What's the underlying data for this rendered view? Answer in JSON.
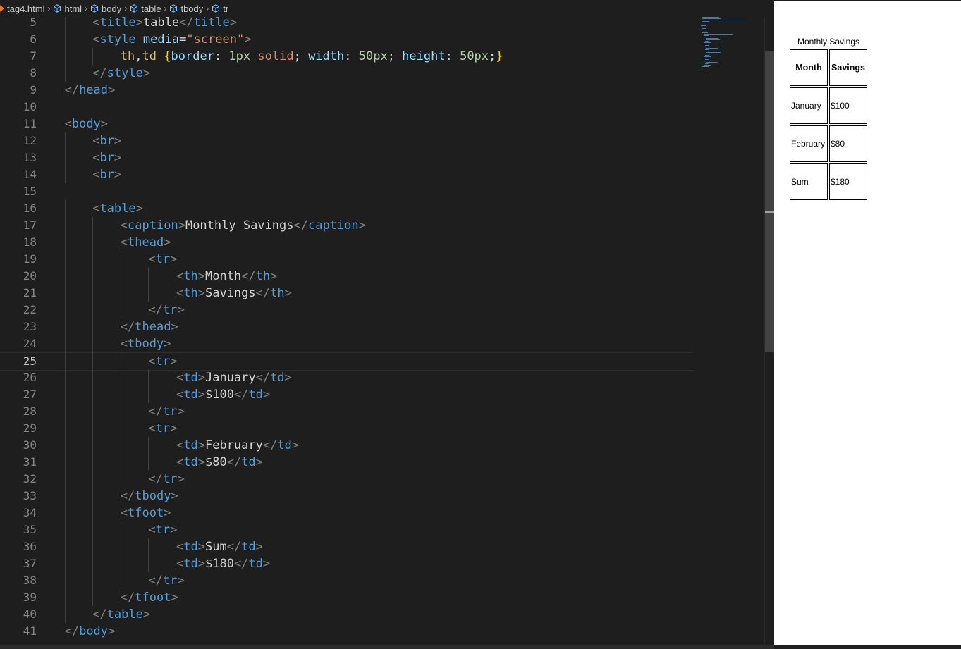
{
  "breadcrumb": {
    "file": "tag4.html",
    "items": [
      "html",
      "body",
      "table",
      "tbody",
      "tr"
    ]
  },
  "editor": {
    "active_line": 25,
    "lines": [
      {
        "n": "5",
        "indent": 2,
        "tokens": [
          [
            "br",
            "<"
          ],
          [
            "tag",
            "title"
          ],
          [
            "br",
            ">"
          ],
          [
            "txt",
            "table"
          ],
          [
            "br",
            "</"
          ],
          [
            "tag",
            "title"
          ],
          [
            "br",
            ">"
          ]
        ]
      },
      {
        "n": "6",
        "indent": 2,
        "tokens": [
          [
            "br",
            "<"
          ],
          [
            "tag",
            "style"
          ],
          [
            "txt",
            " "
          ],
          [
            "attr",
            "media"
          ],
          [
            "txt",
            "="
          ],
          [
            "str",
            "\"screen\""
          ],
          [
            "br",
            ">"
          ]
        ]
      },
      {
        "n": "7",
        "indent": 3,
        "tokens": [
          [
            "sel",
            "th"
          ],
          [
            "txt",
            ","
          ],
          [
            "sel",
            "td"
          ],
          [
            "txt",
            " "
          ],
          [
            "brace",
            "{"
          ],
          [
            "attr",
            "border"
          ],
          [
            "txt",
            ": "
          ],
          [
            "num",
            "1px"
          ],
          [
            "txt",
            " "
          ],
          [
            "val",
            "solid"
          ],
          [
            "txt",
            "; "
          ],
          [
            "attr",
            "width"
          ],
          [
            "txt",
            ": "
          ],
          [
            "num",
            "50px"
          ],
          [
            "txt",
            "; "
          ],
          [
            "attr",
            "height"
          ],
          [
            "txt",
            ": "
          ],
          [
            "num",
            "50px"
          ],
          [
            "txt",
            ";"
          ],
          [
            "brace",
            "}"
          ]
        ]
      },
      {
        "n": "8",
        "indent": 2,
        "tokens": [
          [
            "br",
            "</"
          ],
          [
            "tag",
            "style"
          ],
          [
            "br",
            ">"
          ]
        ]
      },
      {
        "n": "9",
        "indent": 1,
        "tokens": [
          [
            "br",
            "</"
          ],
          [
            "tag",
            "head"
          ],
          [
            "br",
            ">"
          ]
        ]
      },
      {
        "n": "10",
        "indent": 0,
        "tokens": []
      },
      {
        "n": "11",
        "indent": 1,
        "tokens": [
          [
            "br",
            "<"
          ],
          [
            "tag",
            "body"
          ],
          [
            "br",
            ">"
          ]
        ]
      },
      {
        "n": "12",
        "indent": 2,
        "tokens": [
          [
            "br",
            "<"
          ],
          [
            "tag",
            "br"
          ],
          [
            "br",
            ">"
          ]
        ]
      },
      {
        "n": "13",
        "indent": 2,
        "tokens": [
          [
            "br",
            "<"
          ],
          [
            "tag",
            "br"
          ],
          [
            "br",
            ">"
          ]
        ]
      },
      {
        "n": "14",
        "indent": 2,
        "tokens": [
          [
            "br",
            "<"
          ],
          [
            "tag",
            "br"
          ],
          [
            "br",
            ">"
          ]
        ]
      },
      {
        "n": "15",
        "indent": 0,
        "tokens": []
      },
      {
        "n": "16",
        "indent": 2,
        "tokens": [
          [
            "br",
            "<"
          ],
          [
            "tag",
            "table"
          ],
          [
            "br",
            ">"
          ]
        ]
      },
      {
        "n": "17",
        "indent": 3,
        "tokens": [
          [
            "br",
            "<"
          ],
          [
            "tag",
            "caption"
          ],
          [
            "br",
            ">"
          ],
          [
            "txt",
            "Monthly Savings"
          ],
          [
            "br",
            "</"
          ],
          [
            "tag",
            "caption"
          ],
          [
            "br",
            ">"
          ]
        ]
      },
      {
        "n": "18",
        "indent": 3,
        "tokens": [
          [
            "br",
            "<"
          ],
          [
            "tag",
            "thead"
          ],
          [
            "br",
            ">"
          ]
        ]
      },
      {
        "n": "19",
        "indent": 4,
        "tokens": [
          [
            "br",
            "<"
          ],
          [
            "tag",
            "tr"
          ],
          [
            "br",
            ">"
          ]
        ]
      },
      {
        "n": "20",
        "indent": 5,
        "tokens": [
          [
            "br",
            "<"
          ],
          [
            "tag",
            "th"
          ],
          [
            "br",
            ">"
          ],
          [
            "txt",
            "Month"
          ],
          [
            "br",
            "</"
          ],
          [
            "tag",
            "th"
          ],
          [
            "br",
            ">"
          ]
        ]
      },
      {
        "n": "21",
        "indent": 5,
        "tokens": [
          [
            "br",
            "<"
          ],
          [
            "tag",
            "th"
          ],
          [
            "br",
            ">"
          ],
          [
            "txt",
            "Savings"
          ],
          [
            "br",
            "</"
          ],
          [
            "tag",
            "th"
          ],
          [
            "br",
            ">"
          ]
        ]
      },
      {
        "n": "22",
        "indent": 4,
        "tokens": [
          [
            "br",
            "</"
          ],
          [
            "tag",
            "tr"
          ],
          [
            "br",
            ">"
          ]
        ]
      },
      {
        "n": "23",
        "indent": 3,
        "tokens": [
          [
            "br",
            "</"
          ],
          [
            "tag",
            "thead"
          ],
          [
            "br",
            ">"
          ]
        ]
      },
      {
        "n": "24",
        "indent": 3,
        "tokens": [
          [
            "br",
            "<"
          ],
          [
            "tag",
            "tbody"
          ],
          [
            "br",
            ">"
          ]
        ]
      },
      {
        "n": "25",
        "indent": 4,
        "tokens": [
          [
            "br",
            "<"
          ],
          [
            "tag",
            "tr"
          ],
          [
            "br",
            ">"
          ]
        ]
      },
      {
        "n": "26",
        "indent": 5,
        "tokens": [
          [
            "br",
            "<"
          ],
          [
            "tag",
            "td"
          ],
          [
            "br",
            ">"
          ],
          [
            "txt",
            "January"
          ],
          [
            "br",
            "</"
          ],
          [
            "tag",
            "td"
          ],
          [
            "br",
            ">"
          ]
        ]
      },
      {
        "n": "27",
        "indent": 5,
        "tokens": [
          [
            "br",
            "<"
          ],
          [
            "tag",
            "td"
          ],
          [
            "br",
            ">"
          ],
          [
            "txt",
            "$100"
          ],
          [
            "br",
            "</"
          ],
          [
            "tag",
            "td"
          ],
          [
            "br",
            ">"
          ]
        ]
      },
      {
        "n": "28",
        "indent": 4,
        "tokens": [
          [
            "br",
            "</"
          ],
          [
            "tag",
            "tr"
          ],
          [
            "br",
            ">"
          ]
        ]
      },
      {
        "n": "29",
        "indent": 4,
        "tokens": [
          [
            "br",
            "<"
          ],
          [
            "tag",
            "tr"
          ],
          [
            "br",
            ">"
          ]
        ]
      },
      {
        "n": "30",
        "indent": 5,
        "tokens": [
          [
            "br",
            "<"
          ],
          [
            "tag",
            "td"
          ],
          [
            "br",
            ">"
          ],
          [
            "txt",
            "February"
          ],
          [
            "br",
            "</"
          ],
          [
            "tag",
            "td"
          ],
          [
            "br",
            ">"
          ]
        ]
      },
      {
        "n": "31",
        "indent": 5,
        "tokens": [
          [
            "br",
            "<"
          ],
          [
            "tag",
            "td"
          ],
          [
            "br",
            ">"
          ],
          [
            "txt",
            "$80"
          ],
          [
            "br",
            "</"
          ],
          [
            "tag",
            "td"
          ],
          [
            "br",
            ">"
          ]
        ]
      },
      {
        "n": "32",
        "indent": 4,
        "tokens": [
          [
            "br",
            "</"
          ],
          [
            "tag",
            "tr"
          ],
          [
            "br",
            ">"
          ]
        ]
      },
      {
        "n": "33",
        "indent": 3,
        "tokens": [
          [
            "br",
            "</"
          ],
          [
            "tag",
            "tbody"
          ],
          [
            "br",
            ">"
          ]
        ]
      },
      {
        "n": "34",
        "indent": 3,
        "tokens": [
          [
            "br",
            "<"
          ],
          [
            "tag",
            "tfoot"
          ],
          [
            "br",
            ">"
          ]
        ]
      },
      {
        "n": "35",
        "indent": 4,
        "tokens": [
          [
            "br",
            "<"
          ],
          [
            "tag",
            "tr"
          ],
          [
            "br",
            ">"
          ]
        ]
      },
      {
        "n": "36",
        "indent": 5,
        "tokens": [
          [
            "br",
            "<"
          ],
          [
            "tag",
            "td"
          ],
          [
            "br",
            ">"
          ],
          [
            "txt",
            "Sum"
          ],
          [
            "br",
            "</"
          ],
          [
            "tag",
            "td"
          ],
          [
            "br",
            ">"
          ]
        ]
      },
      {
        "n": "37",
        "indent": 5,
        "tokens": [
          [
            "br",
            "<"
          ],
          [
            "tag",
            "td"
          ],
          [
            "br",
            ">"
          ],
          [
            "txt",
            "$180"
          ],
          [
            "br",
            "</"
          ],
          [
            "tag",
            "td"
          ],
          [
            "br",
            ">"
          ]
        ]
      },
      {
        "n": "38",
        "indent": 4,
        "tokens": [
          [
            "br",
            "</"
          ],
          [
            "tag",
            "tr"
          ],
          [
            "br",
            ">"
          ]
        ]
      },
      {
        "n": "39",
        "indent": 3,
        "tokens": [
          [
            "br",
            "</"
          ],
          [
            "tag",
            "tfoot"
          ],
          [
            "br",
            ">"
          ]
        ]
      },
      {
        "n": "40",
        "indent": 2,
        "tokens": [
          [
            "br",
            "</"
          ],
          [
            "tag",
            "table"
          ],
          [
            "br",
            ">"
          ]
        ]
      },
      {
        "n": "41",
        "indent": 1,
        "tokens": [
          [
            "br",
            "</"
          ],
          [
            "tag",
            "body"
          ],
          [
            "br",
            ">"
          ]
        ]
      }
    ]
  },
  "preview": {
    "caption": "Monthly Savings",
    "headers": [
      "Month",
      "Savings"
    ],
    "rows": [
      [
        "January",
        "$100"
      ],
      [
        "February",
        "$80"
      ]
    ],
    "footer": [
      "Sum",
      "$180"
    ]
  },
  "colors": {
    "editor_bg": "#1e1e1e",
    "tag": "#569cd6",
    "bracket": "#808080",
    "attr": "#9cdcfe",
    "string": "#ce9178",
    "number": "#b5cea8",
    "selector": "#d7ba7d"
  }
}
